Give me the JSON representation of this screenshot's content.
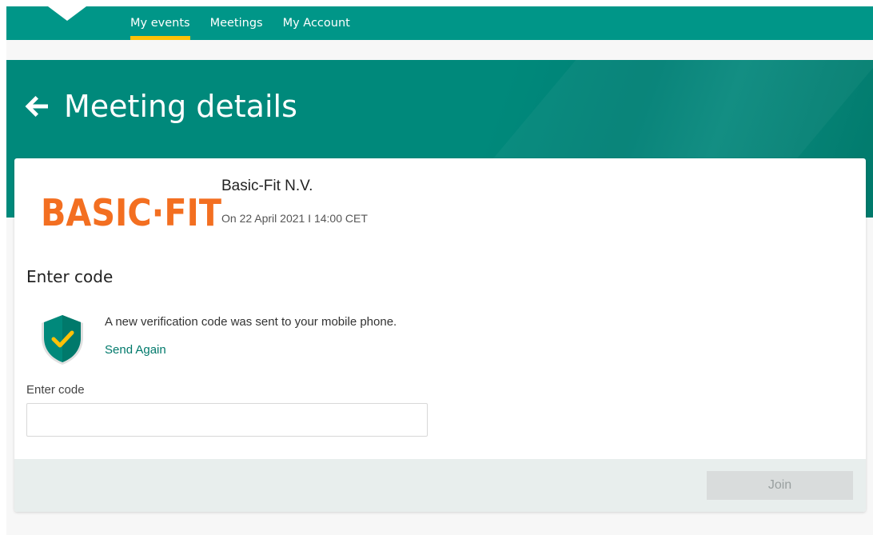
{
  "nav": {
    "items": [
      {
        "label": "My events",
        "active": true
      },
      {
        "label": "Meetings",
        "active": false
      },
      {
        "label": "My Account",
        "active": false
      }
    ],
    "accent_color": "#ffc107",
    "bar_color": "#009688"
  },
  "hero": {
    "title": "Meeting details",
    "back_icon": "arrow-left-icon"
  },
  "event": {
    "logo_text": "BASIC-FIT",
    "logo_color": "#f36f21",
    "company": "Basic-Fit N.V.",
    "date": "On 22 April 2021 I 14:00 CET"
  },
  "verification": {
    "section_title": "Enter code",
    "icon": "shield-check-icon",
    "message": "A new verification code was sent to your mobile phone.",
    "send_again": "Send Again",
    "field_label": "Enter code",
    "field_value": "",
    "field_placeholder": ""
  },
  "footer": {
    "join_label": "Join",
    "join_enabled": false
  }
}
